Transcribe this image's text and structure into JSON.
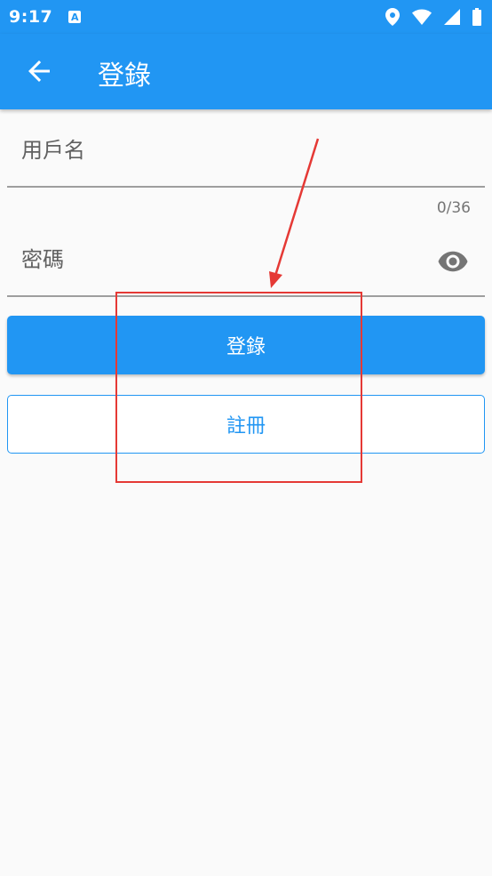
{
  "status_bar": {
    "time": "9:17",
    "notification_icon": "a-box-icon",
    "icons": [
      "location-icon",
      "wifi-icon",
      "cellular-signal-icon",
      "battery-icon"
    ]
  },
  "app_bar": {
    "title": "登錄",
    "back_icon": "arrow-back-icon"
  },
  "form": {
    "username_label": "用戶名",
    "username_counter": "0/36",
    "password_label": "密碼",
    "password_visibility_icon": "eye-icon"
  },
  "buttons": {
    "login_label": "登錄",
    "register_label": "註冊"
  },
  "colors": {
    "primary": "#2196f3",
    "annotation": "#e53935",
    "background": "#fafafa"
  }
}
